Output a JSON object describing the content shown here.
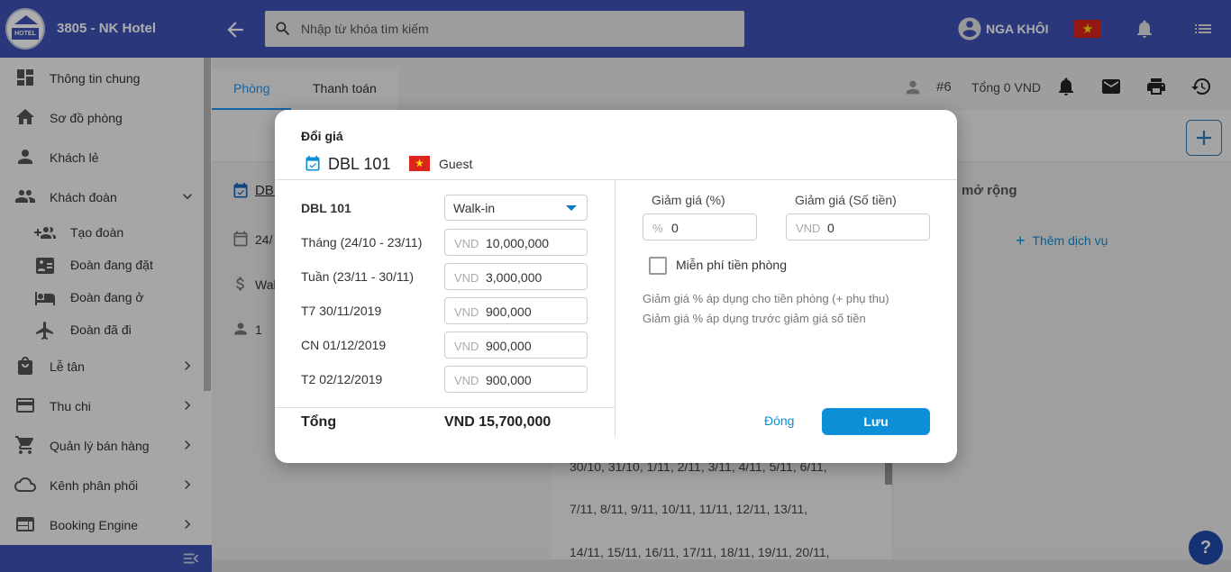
{
  "app": {
    "hotel_name": "3805 - NK Hotel",
    "logo_text": "HOTEL",
    "search_placeholder": "Nhập từ khóa tìm kiếm",
    "user_name": "NGA KHÔI"
  },
  "sidebar": {
    "items": [
      {
        "label": "Thông tin chung",
        "icon": "dashboard-icon"
      },
      {
        "label": "Sơ đồ phòng",
        "icon": "home-icon"
      },
      {
        "label": "Khách lẻ",
        "icon": "person-icon"
      },
      {
        "label": "Khách đoàn",
        "icon": "group-icon"
      },
      {
        "label": "Lễ tân",
        "icon": "bag-icon"
      },
      {
        "label": "Thu chi",
        "icon": "card-icon"
      },
      {
        "label": "Quản lý bán hàng",
        "icon": "cart-icon"
      },
      {
        "label": "Kênh phân phối",
        "icon": "cloud-icon"
      },
      {
        "label": "Booking Engine",
        "icon": "browser-icon"
      }
    ],
    "subitems": [
      {
        "label": "Tạo đoàn",
        "icon": "group-add-icon"
      },
      {
        "label": "Đoàn đang đặt",
        "icon": "id-card-icon"
      },
      {
        "label": "Đoàn đang ở",
        "icon": "bed-icon"
      },
      {
        "label": "Đoàn đã đi",
        "icon": "airplane-icon"
      }
    ]
  },
  "main": {
    "tabs": [
      {
        "label": "Phòng",
        "active": true
      },
      {
        "label": "Thanh toán",
        "active": false
      }
    ],
    "booking_no": "#6",
    "total": "Tổng 0 VND",
    "left_room": "DBL",
    "left_date": "24/",
    "left_rate": "Wal",
    "left_count": "1",
    "right_title": "mở rộng",
    "add_service": "Thêm dịch vụ",
    "dates_lines": [
      "30/10, 31/10, 1/11, 2/11, 3/11, 4/11, 5/11, 6/11,",
      "7/11, 8/11, 9/11, 10/11, 11/11, 12/11, 13/11,",
      "14/11, 15/11, 16/11, 17/11, 18/11, 19/11, 20/11,"
    ],
    "help": "?"
  },
  "dialog": {
    "title": "Đổi giá",
    "room": "DBL 101",
    "guest": "Guest",
    "rate_label": "DBL 101",
    "rate_plan": "Walk-in",
    "rows": [
      {
        "label": "Tháng (24/10 - 23/11)",
        "currency": "VND",
        "value": "10,000,000"
      },
      {
        "label": "Tuần (23/11 - 30/11)",
        "currency": "VND",
        "value": "3,000,000"
      },
      {
        "label": "T7 30/11/2019",
        "currency": "VND",
        "value": "900,000"
      },
      {
        "label": "CN 01/12/2019",
        "currency": "VND",
        "value": "900,000"
      },
      {
        "label": "T2 02/12/2019",
        "currency": "VND",
        "value": "900,000"
      }
    ],
    "total_label": "Tổng",
    "total_value": "VND 15,700,000",
    "discount_pct_label": "Giảm giá (%)",
    "discount_pct_symbol": "%",
    "discount_pct_value": "0",
    "discount_amt_label": "Giảm giá (Số tiền)",
    "discount_amt_currency": "VND",
    "discount_amt_value": "0",
    "free_room_label": "Miễn phí tiền phòng",
    "note_1": "Giảm giá % áp dụng cho tiền phòng (+ phụ thu)",
    "note_2": "Giảm giá % áp dụng trước giảm giá số tiền",
    "close_label": "Đóng",
    "save_label": "Lưu"
  },
  "colors": {
    "primary": "#3f51b5",
    "accent": "#0b8fd6",
    "flag": "#da251d"
  }
}
